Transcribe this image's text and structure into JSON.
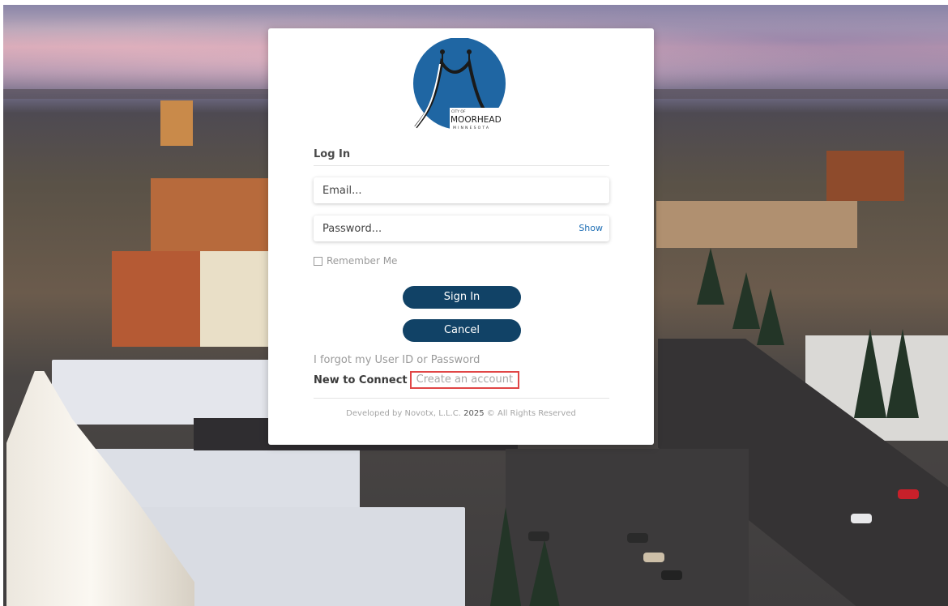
{
  "branding": {
    "logo_small_text": "CITY OF",
    "logo_name": "MOORHEAD",
    "logo_state": "MINNESOTA",
    "logo_color": "#1f66a3"
  },
  "login": {
    "section_title": "Log In",
    "email_placeholder": "Email...",
    "password_placeholder": "Password...",
    "show_label": "Show",
    "remember_label": "Remember Me",
    "remember_checked": false,
    "sign_in_label": "Sign In",
    "cancel_label": "Cancel",
    "forgot_link": "I forgot my User ID or Password",
    "new_user_label": "New to Connect",
    "create_account_link": "Create an account"
  },
  "footer": {
    "developer": "Developed by Novotx, L.L.C.",
    "year": "2025",
    "rights": "© All Rights Reserved"
  },
  "colors": {
    "button": "#114266",
    "link": "#1f6fb5",
    "highlight_box": "#e04646"
  }
}
